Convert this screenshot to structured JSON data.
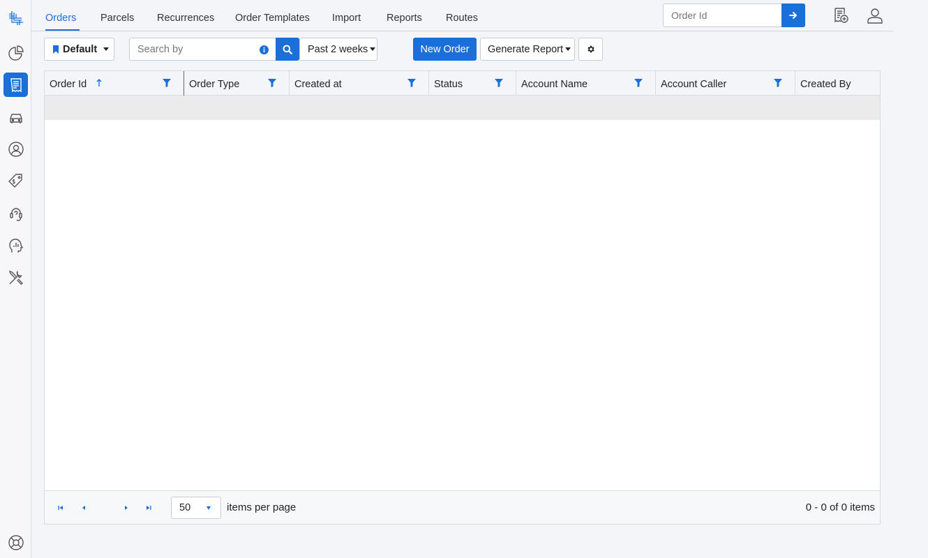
{
  "nav": {
    "tabs": [
      {
        "label": "Orders",
        "active": true
      },
      {
        "label": "Parcels"
      },
      {
        "label": "Recurrences"
      },
      {
        "label": "Order Templates"
      },
      {
        "label": "Import"
      },
      {
        "label": "Reports"
      },
      {
        "label": "Routes"
      }
    ],
    "order_id_placeholder": "Order Id"
  },
  "toolbar": {
    "view_label": "Default",
    "search_placeholder": "Search by",
    "date_range_label": "Past 2 weeks",
    "new_order_label": "New Order",
    "generate_report_label": "Generate Report"
  },
  "grid": {
    "columns": [
      {
        "label": "Order Id",
        "sorted": "ascending"
      },
      {
        "label": "Order Type"
      },
      {
        "label": "Created at"
      },
      {
        "label": "Status"
      },
      {
        "label": "Account Name"
      },
      {
        "label": "Account Caller"
      },
      {
        "label": "Created By"
      }
    ],
    "page_size": "50",
    "items_per_page_label": "items per page",
    "count_label": "0 - 0 of 0 items"
  },
  "colors": {
    "accent": "#1b6fd8",
    "background": "#f4f5f9",
    "border": "#d8dbe1"
  }
}
